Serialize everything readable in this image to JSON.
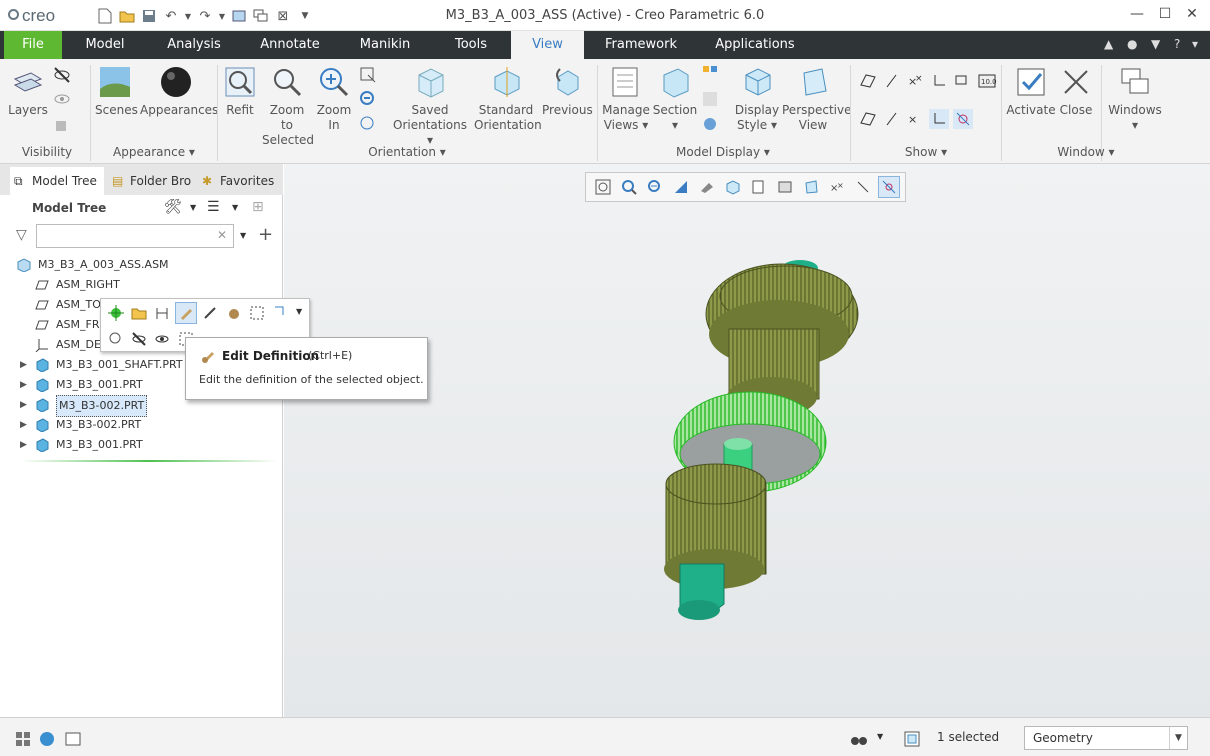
{
  "app": {
    "logo_text": "creo",
    "window_title": "M3_B3_A_003_ASS (Active) - Creo Parametric 6.0"
  },
  "tabs": [
    {
      "label": "File"
    },
    {
      "label": "Model"
    },
    {
      "label": "Analysis"
    },
    {
      "label": "Annotate"
    },
    {
      "label": "Manikin"
    },
    {
      "label": "Tools"
    },
    {
      "label": "View"
    },
    {
      "label": "Framework"
    },
    {
      "label": "Applications"
    }
  ],
  "ribbon": {
    "visibility": {
      "layers": "Layers",
      "group": "Visibility"
    },
    "appearance": {
      "scenes": "Scenes",
      "appearances": "Appearances",
      "group": "Appearance"
    },
    "orientation": {
      "refit": "Refit",
      "zoom_selected_1": "Zoom to",
      "zoom_selected_2": "Selected",
      "zoom_in_1": "Zoom",
      "zoom_in_2": "In",
      "saved_1": "Saved",
      "saved_2": "Orientations",
      "standard_1": "Standard",
      "standard_2": "Orientation",
      "previous": "Previous",
      "group": "Orientation"
    },
    "model_display": {
      "manage_1": "Manage",
      "manage_2": "Views",
      "section": "Section",
      "display_1": "Display",
      "display_2": "Style",
      "persp_1": "Perspective",
      "persp_2": "View",
      "group": "Model Display"
    },
    "show": {
      "group": "Show"
    },
    "window": {
      "activate": "Activate",
      "close": "Close",
      "windows": "Windows",
      "group": "Window"
    }
  },
  "panel": {
    "tabs": [
      "Model Tree",
      "Folder Bro",
      "Favorites"
    ],
    "header": "Model Tree",
    "search_value": "",
    "tree": [
      {
        "label": "M3_B3_A_003_ASS.ASM",
        "icon": "assembly-icon",
        "arrow": ""
      },
      {
        "label": "ASM_RIGHT",
        "icon": "datum-plane-icon",
        "arrow": ""
      },
      {
        "label": "ASM_TOP",
        "icon": "datum-plane-icon",
        "arrow": ""
      },
      {
        "label": "ASM_FRONT",
        "icon": "datum-plane-icon",
        "arrow": ""
      },
      {
        "label": "ASM_DEF_CSYS",
        "icon": "csys-icon",
        "arrow": ""
      },
      {
        "label": "M3_B3_001_SHAFT.PRT",
        "icon": "part-icon",
        "arrow": "▶"
      },
      {
        "label": "M3_B3_001.PRT",
        "icon": "part-icon",
        "arrow": "▶"
      },
      {
        "label": "M3_B3-002.PRT",
        "icon": "part-icon",
        "arrow": "▶"
      },
      {
        "label": "M3_B3-002.PRT",
        "icon": "part-icon",
        "arrow": "▶"
      },
      {
        "label": "M3_B3_001.PRT",
        "icon": "part-icon",
        "arrow": "▶"
      }
    ]
  },
  "tooltip": {
    "title": "Edit Definition",
    "shortcut": "(Ctrl+E)",
    "description": "Edit the definition of the selected object."
  },
  "status": {
    "selected": "1 selected",
    "filter": "Geometry"
  },
  "colors": {
    "file_tab": "#5fb832",
    "tabbar": "#2f3437",
    "active_tab_text": "#3a7dc2",
    "gear_olive": "#8f9a48",
    "gear_selected": "#3fcf3f",
    "shaft_teal": "#1fb08a"
  }
}
